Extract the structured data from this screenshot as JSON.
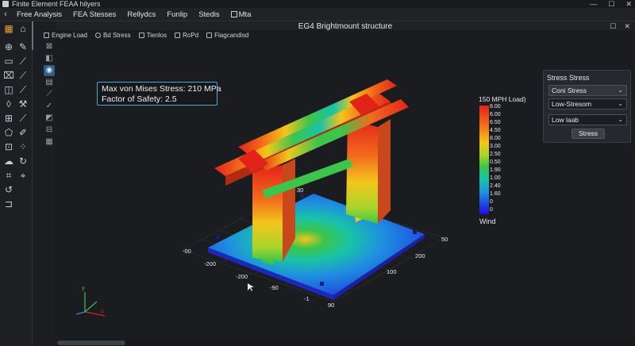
{
  "window": {
    "title": "Finite Element FEAA hilyers"
  },
  "menu": {
    "items": [
      "Free Analysis",
      "FEA Stesses",
      "Rellydcs",
      "Funlip",
      "Stedis"
    ],
    "checkbox_item": "Mta"
  },
  "viewport": {
    "title": "EG4 Brightmount structure"
  },
  "subtoolbar": [
    "Engine Load",
    "Bd Stress",
    "Tienlos",
    "RoPd",
    "Flagcandisd"
  ],
  "info": {
    "line1": "Max von Mises Stress: 210 MPa",
    "line2": "Factor of Safety: 2.5"
  },
  "legend": {
    "title": "150 MPH Load)",
    "ticks": [
      "8.00",
      "6.00",
      "6.50",
      "4.50",
      "8.00",
      "3.00",
      "2.50",
      "0.50",
      "1.90",
      "1.00",
      "2.40",
      "1.60",
      "0",
      "0"
    ],
    "footer": "Wind"
  },
  "panel": {
    "title": "Stress Stress",
    "select1": "Coni Stress",
    "select2": "Low-Stresom",
    "select3": "Low laab",
    "button": "Stress"
  },
  "axis_labels": [
    "30",
    "50",
    "-00",
    "-200",
    "-200",
    "-90",
    "-1",
    "100",
    "200",
    "90",
    "80",
    "60",
    "0"
  ],
  "triad": {
    "y": "y",
    "x": "x"
  },
  "colors": {
    "accent": "#4aa6d9",
    "background": "#1a1c20"
  }
}
